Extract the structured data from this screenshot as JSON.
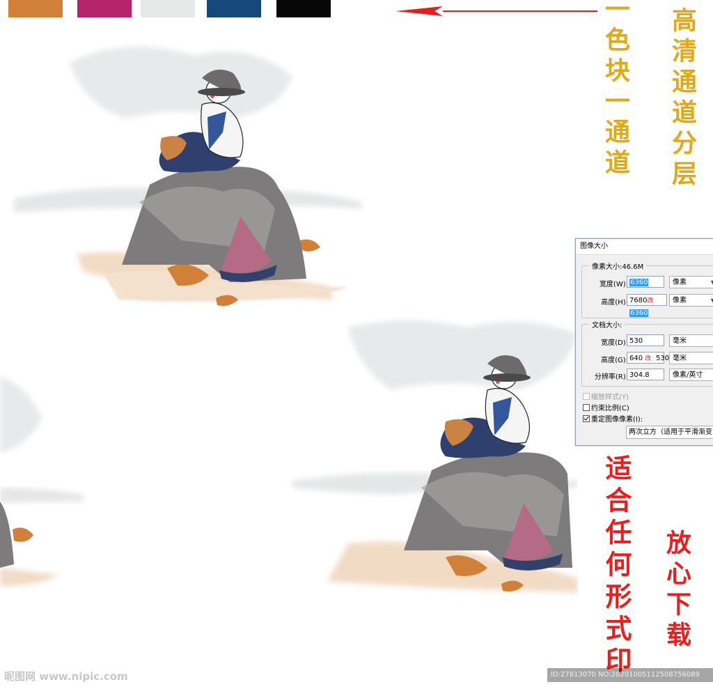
{
  "swatches": [
    {
      "name": "orange-swatch",
      "color": "#d1803a"
    },
    {
      "name": "magenta-swatch",
      "color": "#b3246a"
    },
    {
      "name": "light-gray-swatch",
      "color": "#e6e9e7"
    },
    {
      "name": "navy-swatch",
      "color": "#17487b"
    },
    {
      "name": "black-swatch",
      "color": "#070707"
    }
  ],
  "labels": {
    "color_block": "一色块一通道",
    "hd_channels": "高清通道分层",
    "any_print": "适合任何形式印",
    "download": "放心下载"
  },
  "dialog": {
    "title": "图像大小",
    "pixel_size": "像素大小:46.6M",
    "width_label": "宽度(W):",
    "width_value": "6360",
    "width_unit": "像素",
    "height_label": "高度(H):",
    "height_value_old": "7680",
    "height_mark": "改",
    "height_value_new": "6360",
    "height_unit": "像素",
    "doc_size": "文档大小:",
    "doc_width_label": "宽度(D):",
    "doc_width_value": "530",
    "doc_width_unit": "毫米",
    "doc_height_label": "高度(G):",
    "doc_height_old": "640",
    "doc_height_mark": "改",
    "doc_height_new": "530",
    "doc_height_unit": "毫米",
    "resolution_label": "分辨率(R):",
    "resolution_value": "304.8",
    "resolution_unit": "像素/英寸",
    "scale_styles": "缩放样式(Y)",
    "constrain": "约束比例(C)",
    "resample": "重定图像像素(I):",
    "method": "两次立方（适用于平滑渐变"
  },
  "watermark": {
    "site": "昵图网 www.nipic.com",
    "id_line": "ID:27813070 NO:20201005112508756089"
  }
}
